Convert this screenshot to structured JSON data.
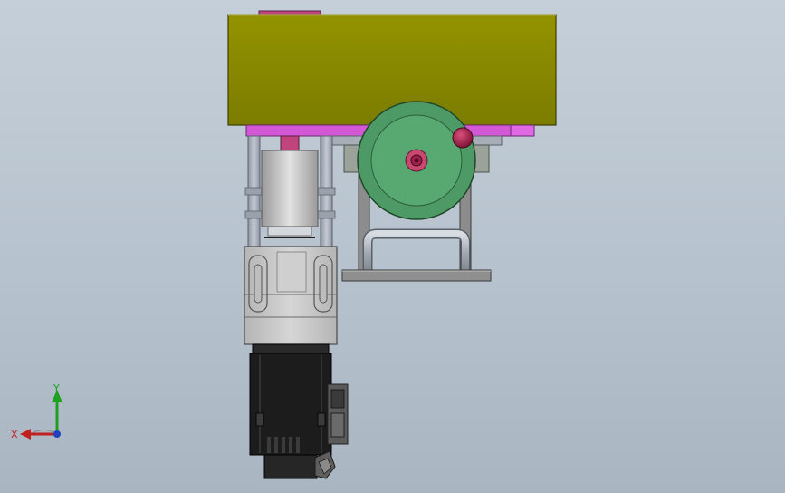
{
  "viewport": {
    "background_top": "#c5cfd9",
    "background_bottom": "#a9b6c2"
  },
  "model": {
    "parts": [
      "top-housing",
      "pink-mounting-plate",
      "coupling-shaft",
      "motor-coupler",
      "support-rods",
      "gear-reducer",
      "servo-motor",
      "motor-connector",
      "green-handwheel",
      "handwheel-knob",
      "handwheel-bracket",
      "u-handle",
      "base-plate"
    ],
    "colors": {
      "housing": "#8a8a00",
      "plate": "#d258d6",
      "handwheel": "#4e9a66",
      "knob": "#a01848",
      "motor": "#1c1c1c",
      "reducer": "#c8c8c8",
      "bracket": "#8c8c8c"
    }
  },
  "triad": {
    "x_label": "X",
    "y_label": "Y",
    "x_color": "#c02020",
    "y_color": "#20a020",
    "z_color": "#2040c0"
  }
}
